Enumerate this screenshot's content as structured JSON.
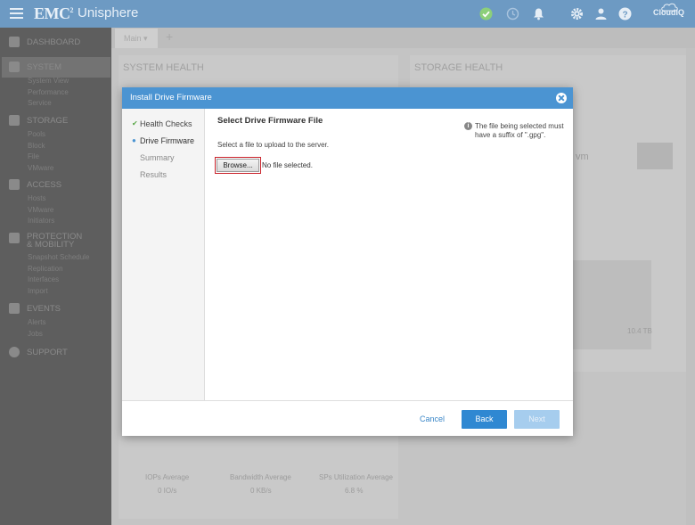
{
  "header": {
    "brand": "EMC",
    "brand_sup": "2",
    "product": "Unisphere",
    "cloudiq": "CloudIQ",
    "icons": [
      "menu-icon",
      "check-status-icon",
      "clock-icon",
      "alert-bell-icon",
      "gear-icon",
      "user-icon",
      "help-icon",
      "cloudiq-icon"
    ]
  },
  "sidebar": {
    "dashboard": "DASHBOARD",
    "sections": [
      {
        "title": "SYSTEM",
        "items": [
          "System View",
          "Performance",
          "Service"
        ]
      },
      {
        "title": "STORAGE",
        "items": [
          "Pools",
          "Block",
          "File",
          "VMware"
        ]
      },
      {
        "title": "ACCESS",
        "items": [
          "Hosts",
          "VMware",
          "Initiators"
        ]
      },
      {
        "title": "PROTECTION & MOBILITY",
        "items": [
          "Snapshot Schedule",
          "Replication",
          "Interfaces",
          "Import"
        ]
      },
      {
        "title": "EVENTS",
        "items": [
          "Alerts",
          "Jobs"
        ]
      },
      {
        "title": "SUPPORT",
        "items": []
      }
    ]
  },
  "tabs": {
    "main": "Main ▾",
    "add": "+"
  },
  "background": {
    "system_health": "SYSTEM HEALTH",
    "storage_health": "STORAGE HEALTH",
    "vm_text": "vm",
    "capacity": "10.4 TB",
    "metrics": [
      {
        "label": "IOPs Average",
        "value": "0 IO/s"
      },
      {
        "label": "Bandwidth Average",
        "value": "0 KB/s"
      },
      {
        "label": "SPs Utilization Average",
        "value": "6.8 %"
      }
    ]
  },
  "dialog": {
    "title": "Install Drive Firmware",
    "steps": [
      {
        "label": "Health Checks",
        "state": "done"
      },
      {
        "label": "Drive Firmware",
        "state": "current"
      },
      {
        "label": "Summary",
        "state": "pending"
      },
      {
        "label": "Results",
        "state": "pending"
      }
    ],
    "heading": "Select Drive Firmware File",
    "instruction": "Select a file to upload to the server.",
    "browse_label": "Browse...",
    "no_file": "No file selected.",
    "info": "The file being selected must have a suffix of \".gpg\".",
    "cancel": "Cancel",
    "back": "Back",
    "next": "Next"
  },
  "colors": {
    "header": "#6d9ac3",
    "dialog_header": "#4b94d2",
    "primary_button": "#2f88d2",
    "highlight": "#c9222a"
  }
}
